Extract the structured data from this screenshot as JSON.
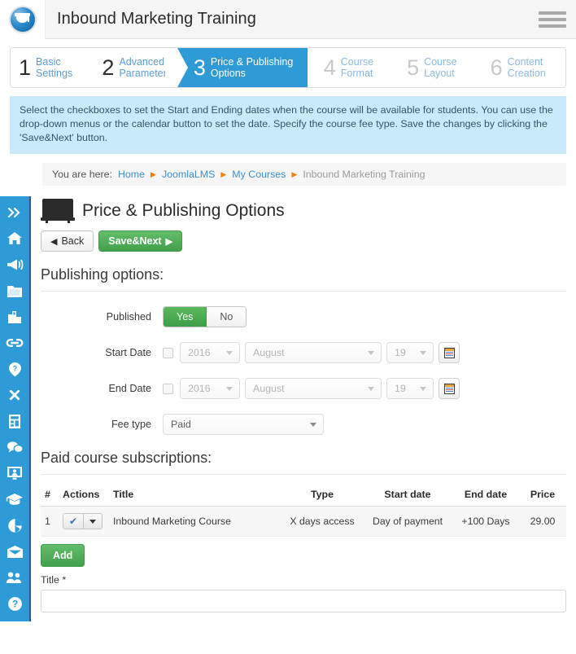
{
  "header": {
    "logo_icon": "graduation-cap-logo",
    "title": "Inbound Marketing Training",
    "menu_icon": "hamburger-menu-icon"
  },
  "wizard": {
    "steps": [
      {
        "num": "1",
        "line1": "Basic",
        "line2": "Settings",
        "state": "done"
      },
      {
        "num": "2",
        "line1": "Advanced",
        "line2": "Parameters",
        "state": "done"
      },
      {
        "num": "3",
        "line1": "Price & Publishing",
        "line2": "Options",
        "state": "active"
      },
      {
        "num": "4",
        "line1": "Course",
        "line2": "Format",
        "state": "pending"
      },
      {
        "num": "5",
        "line1": "Course",
        "line2": "Layout",
        "state": "pending"
      },
      {
        "num": "6",
        "line1": "Content",
        "line2": "Creation",
        "state": "pending"
      }
    ],
    "active_color": "#2e9bd6"
  },
  "info": {
    "text": "Select the checkboxes to set the Start and Ending dates when the course will be available for students. You can use the drop-down menus or the calendar button to set the date. Specify the course fee type. Save the changes by clicking the 'Save&Next' button."
  },
  "sidebar": {
    "background": "#2e9bd6",
    "items": [
      {
        "icon": "double-chevron-right-icon"
      },
      {
        "icon": "home-icon"
      },
      {
        "icon": "megaphone-icon"
      },
      {
        "icon": "folder-icon"
      },
      {
        "icon": "bar-chart-icon"
      },
      {
        "icon": "link-icon"
      },
      {
        "icon": "question-marker-icon"
      },
      {
        "icon": "tools-icon"
      },
      {
        "icon": "clipboard-icon"
      },
      {
        "icon": "chat-bubbles-icon"
      },
      {
        "icon": "user-monitor-icon"
      },
      {
        "icon": "graduation-cap-icon"
      },
      {
        "icon": "pie-chart-icon"
      },
      {
        "icon": "envelope-icon"
      },
      {
        "icon": "users-group-icon"
      },
      {
        "icon": "help-circle-icon"
      }
    ]
  },
  "breadcrumb": {
    "prefix": "You are here:",
    "items": [
      "Home",
      "JoomlaLMS",
      "My Courses"
    ],
    "current": "Inbound Marketing Training",
    "separator": "▶"
  },
  "page": {
    "icon": "blackboard-icon",
    "title": "Price & Publishing Options",
    "back_label": "Back",
    "back_icon": "chevron-left-icon",
    "save_label": "Save&Next",
    "save_icon": "chevron-right-icon",
    "section_title": "Publishing options:"
  },
  "form": {
    "published": {
      "label": "Published",
      "yes": "Yes",
      "no": "No",
      "selected": "Yes"
    },
    "start_date": {
      "label": "Start Date",
      "checked": false,
      "year": "2016",
      "month": "August",
      "day": "19",
      "calendar_icon": "calendar-icon"
    },
    "end_date": {
      "label": "End Date",
      "checked": false,
      "year": "2016",
      "month": "August",
      "day": "19",
      "calendar_icon": "calendar-icon"
    },
    "fee_type": {
      "label": "Fee type",
      "value": "Paid"
    }
  },
  "subscriptions": {
    "title": "Paid course subscriptions:",
    "columns": [
      "#",
      "Actions",
      "Title",
      "Type",
      "Start date",
      "End date",
      "Price"
    ],
    "rows": [
      {
        "num": "1",
        "action_icon": "check-mark-icon",
        "title": "Inbound Marketing Course",
        "type": "X days access",
        "start_date": "Day of payment",
        "end_date": "+100 Days",
        "price": "29.00"
      }
    ],
    "add_label": "Add"
  },
  "title_field": {
    "label": "Title",
    "required_marker": "*",
    "value": ""
  }
}
